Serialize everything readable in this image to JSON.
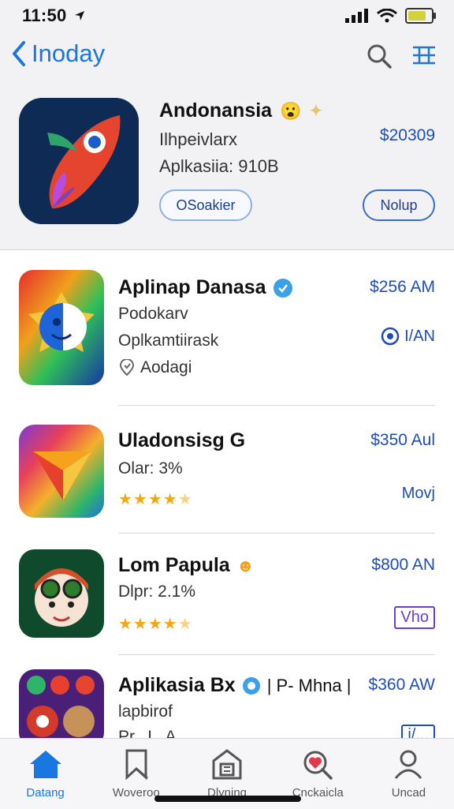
{
  "status_bar": {
    "time": "11:50"
  },
  "nav": {
    "back_label": "Inoday"
  },
  "featured": {
    "title": "Andonansia",
    "subtitle": "Ilhpeivlarx",
    "size": "Aplkasiia: 910B",
    "price": "$20309",
    "tag": "OSoakier",
    "action": "Nolup"
  },
  "apps": [
    {
      "title": "Aplinap Danasa",
      "line1": "Podokarv",
      "line2": "Oplkamtiirask",
      "location": "Aodagi",
      "price": "$256 AM",
      "action": "I/AN"
    },
    {
      "title": "Uladonsisg G",
      "line1": "Olar: 3%",
      "price": "$350 Aul",
      "action": "Movj",
      "rating": 4.5
    },
    {
      "title": "Lom Papula",
      "line1": "Dlpr: 2.1%",
      "price": "$800 AN",
      "action": "Vho",
      "rating": 4.5
    },
    {
      "title": "Aplikasia Bx",
      "title_extra": "| P- Mhna |",
      "line1": "lapbirof",
      "line2": "Pr.,  L.  A",
      "price": "$360 AW",
      "action": "i/..."
    }
  ],
  "tabs": [
    {
      "label": "Datang",
      "icon": "home-icon",
      "active": true
    },
    {
      "label": "Woveroo",
      "icon": "bookmark-icon",
      "active": false
    },
    {
      "label": "Dlyning",
      "icon": "store-icon",
      "active": false
    },
    {
      "label": "Cnckaicla",
      "icon": "search-heart-icon",
      "active": false
    },
    {
      "label": "Uncad",
      "icon": "person-icon",
      "active": false
    }
  ],
  "colors": {
    "accent": "#1a76e0",
    "price": "#1f4db8",
    "star": "#f3a713"
  }
}
